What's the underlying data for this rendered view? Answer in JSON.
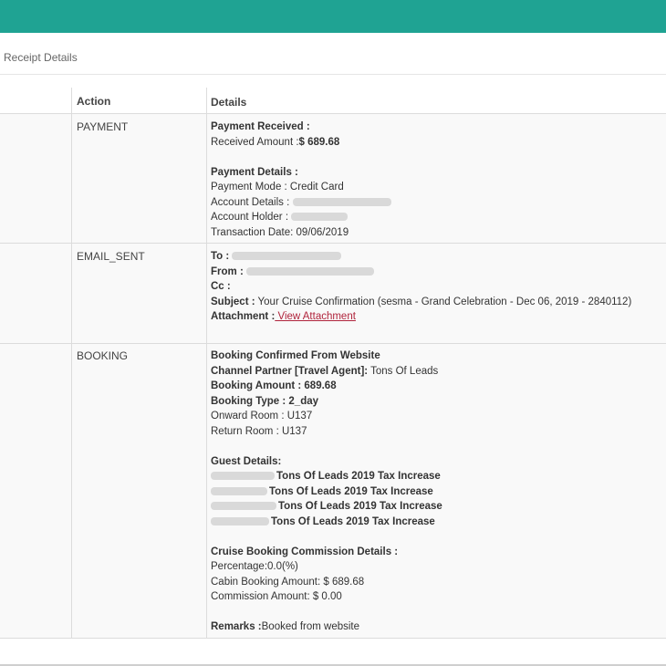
{
  "header": {
    "subtitle": "Receipt Details"
  },
  "table": {
    "columns": {
      "action": "Action",
      "details": "Details"
    },
    "payment": {
      "action": "PAYMENT",
      "received_label": "Payment Received :",
      "received_amount_label": "Received Amount :",
      "received_amount_value": "$ 689.68",
      "details_label": "Payment Details :",
      "mode": "Payment Mode : Credit Card",
      "account_details_label": "Account Details :",
      "account_holder_label": "Account Holder :",
      "transaction_date": "Transaction Date: 09/06/2019"
    },
    "email": {
      "action": "EMAIL_SENT",
      "to_label": "To :",
      "from_label": "From :",
      "cc_label": "Cc :",
      "subject_label": "Subject :",
      "subject_value": " Your Cruise Confirmation (sesma - Grand Celebration - Dec 06, 2019 - 2840112)",
      "attachment_label": "Attachment :",
      "attachment_link": " View Attachment"
    },
    "booking": {
      "action": "BOOKING",
      "confirmed": "Booking Confirmed From Website",
      "channel_label": "Channel Partner [Travel Agent]:",
      "channel_value": " Tons Of Leads",
      "amount": "Booking Amount : 689.68",
      "type": "Booking Type : 2_day",
      "onward_room": "Onward Room : U137",
      "return_room": "Return Room : U137",
      "guest_label": "Guest Details:",
      "guests": [
        "Tons Of Leads 2019 Tax Increase",
        "Tons Of Leads 2019 Tax Increase",
        "Tons Of Leads 2019 Tax Increase",
        "Tons Of Leads 2019 Tax Increase"
      ],
      "commission_label": "Cruise Booking Commission Details :",
      "percentage": "Percentage:0.0(%)",
      "cabin_amount": "Cabin Booking Amount: $ 689.68",
      "commission_amount": "Commission Amount: $ 0.00",
      "remarks_label": "Remarks :",
      "remarks_value": "Booked from website"
    }
  }
}
